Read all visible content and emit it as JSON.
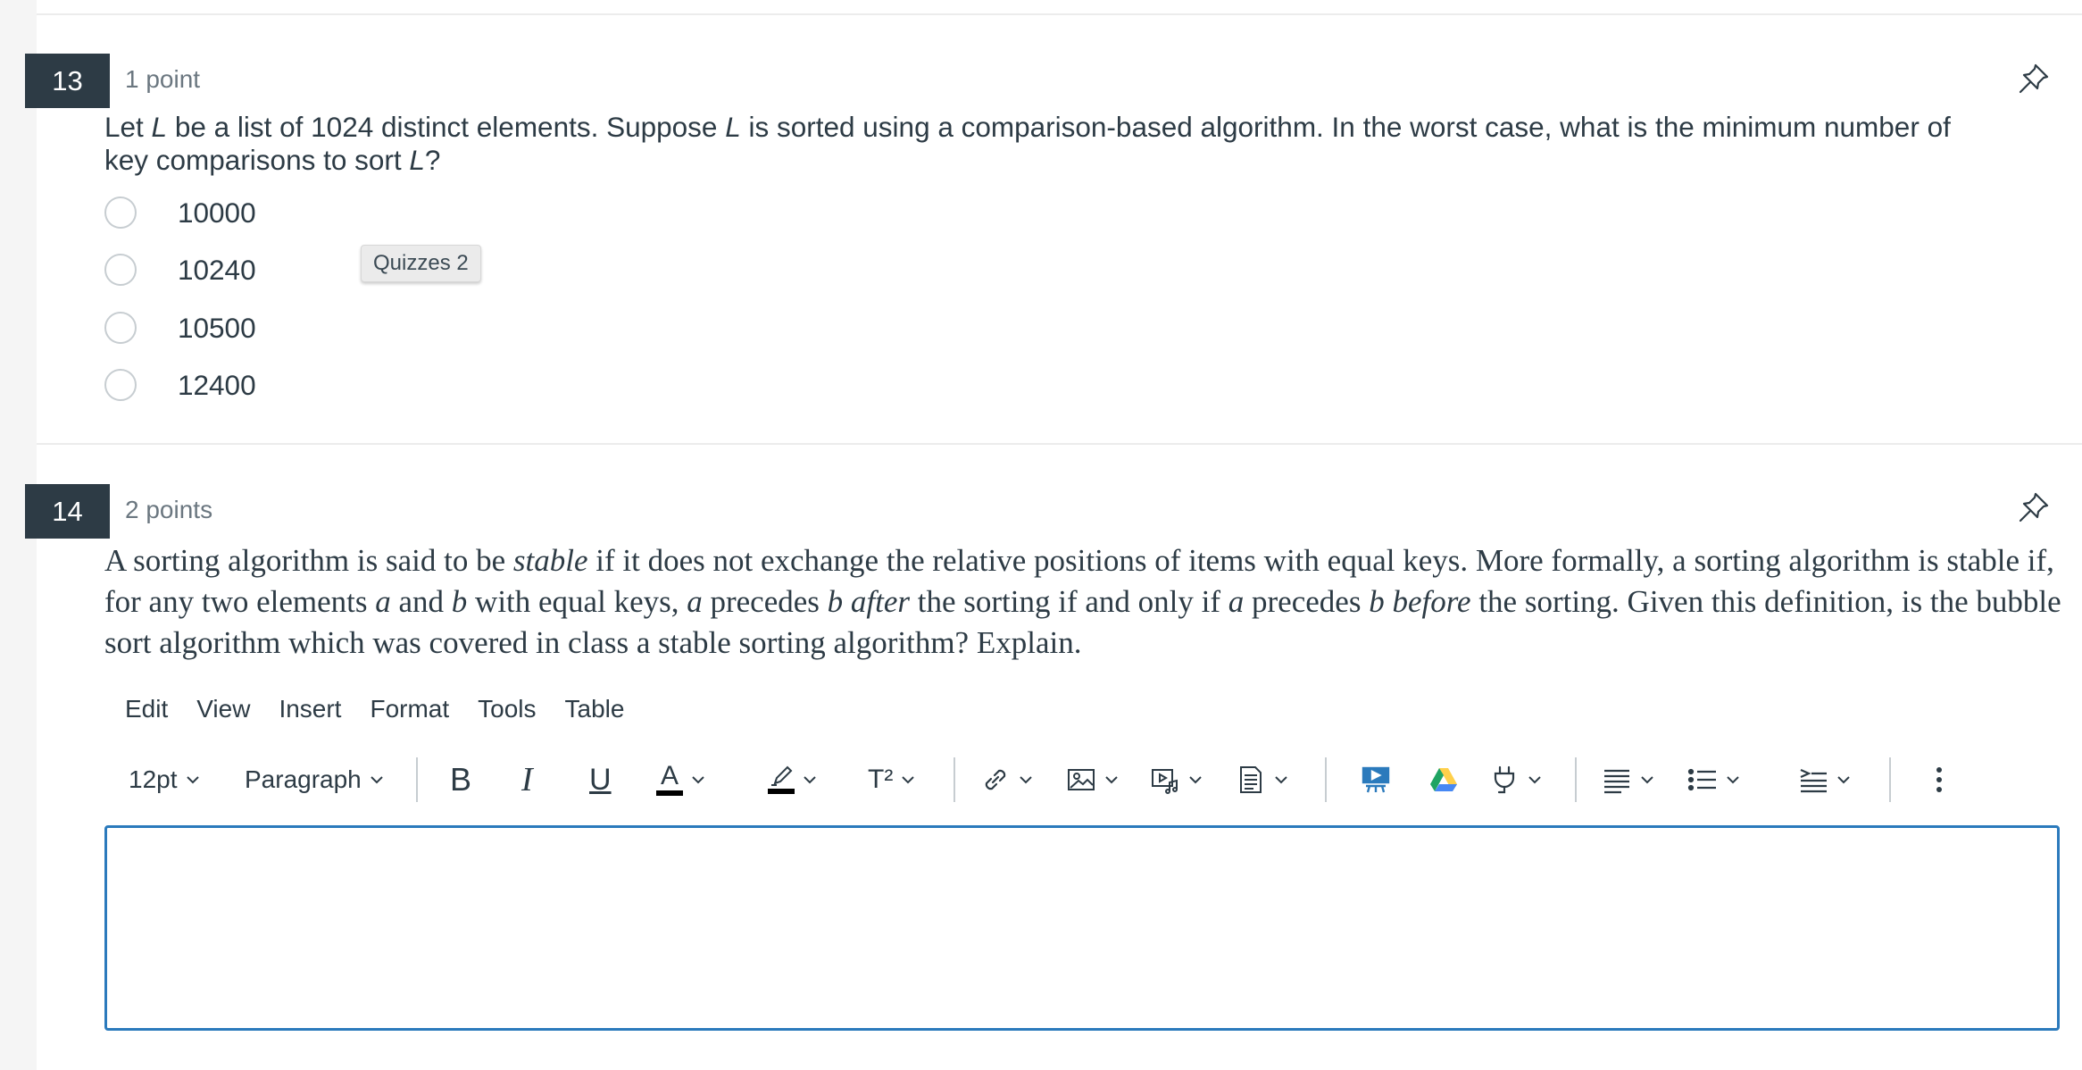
{
  "question13": {
    "number": "13",
    "points": "1 point",
    "text_parts": [
      "Let ",
      "L",
      " be a list of 1024 distinct elements. Suppose ",
      "L",
      " is sorted using a comparison-based algorithm. In the worst case, what is the minimum number of key comparisons to sort ",
      "L",
      "?"
    ],
    "options": [
      "10000",
      "10240",
      "10500",
      "12400"
    ],
    "selected_option": null
  },
  "tooltip": {
    "label": "Quizzes 2"
  },
  "question14": {
    "number": "14",
    "points": "2 points",
    "text_parts": [
      "A sorting algorithm is said to be ",
      "stable",
      " if it does not exchange the relative positions of items with equal keys. More formally, a sorting algorithm is stable if, for any two elements ",
      "a",
      " and ",
      "b",
      " with equal keys, ",
      "a",
      " precedes ",
      "b",
      " ",
      "after",
      " the sorting if and only if ",
      "a",
      " precedes ",
      "b",
      " ",
      "before",
      " the sorting. Given this definition, is the bubble sort algorithm which was covered in class a stable sorting algorithm? Explain."
    ]
  },
  "editor": {
    "menu": [
      "Edit",
      "View",
      "Insert",
      "Format",
      "Tools",
      "Table"
    ],
    "font_size": "12pt",
    "block_format": "Paragraph",
    "bold_label": "B",
    "italic_label": "I",
    "underline_label": "U",
    "font_color_label": "A",
    "superscript_label": "T²",
    "content": ""
  },
  "icons": [
    "pin-icon",
    "bold-icon",
    "italic-icon",
    "underline-icon",
    "text-color-icon",
    "highlight-icon",
    "superscript-icon",
    "link-icon",
    "image-icon",
    "media-icon",
    "document-icon",
    "apps-icon",
    "google-drive-icon",
    "plugin-icon",
    "align-icon",
    "list-icon",
    "indent-icon",
    "more-icon",
    "chevron-down-icon"
  ],
  "colors": {
    "question_number_bg": "#2d3b45",
    "editor_border": "#2b7abc",
    "drive_green": "#1fa463",
    "drive_yellow": "#ffd04b",
    "drive_blue": "#4688f4"
  }
}
